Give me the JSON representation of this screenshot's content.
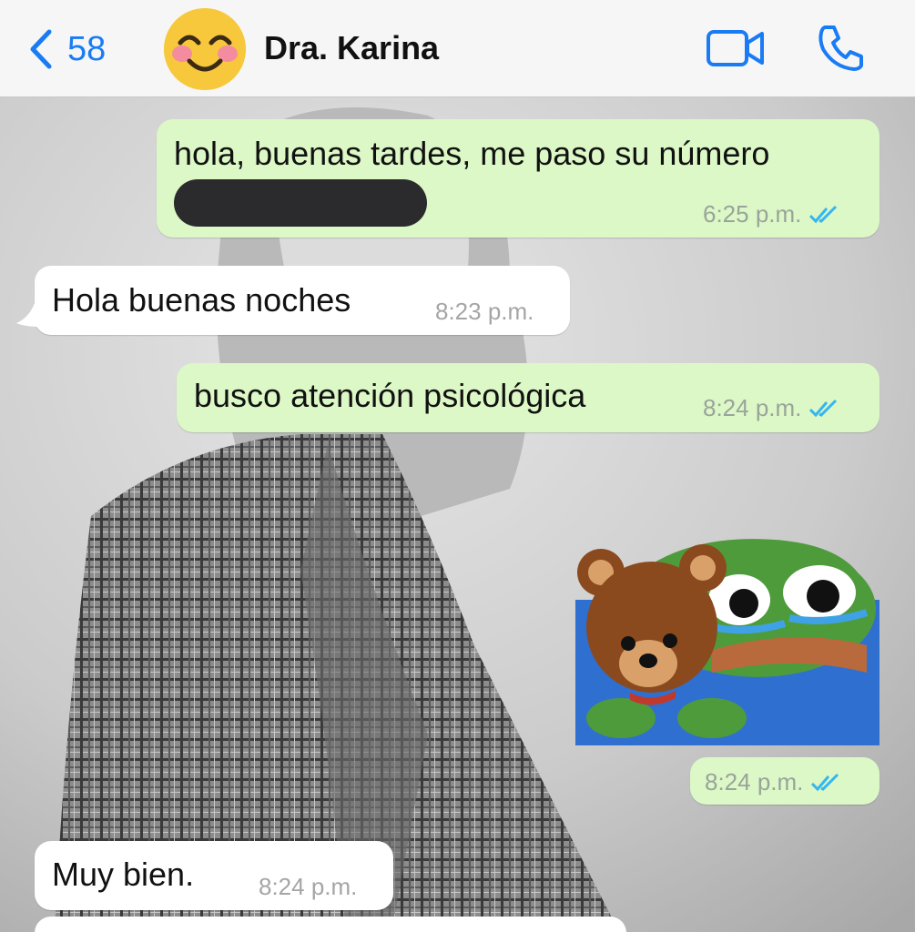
{
  "header": {
    "back_count": "58",
    "contact_name": "Dra. Karina",
    "avatar_emoji": "smiling-face-with-smiling-eyes"
  },
  "colors": {
    "accent": "#1a7cf5",
    "outgoing_bubble": "#dcf8c6",
    "incoming_bubble": "#ffffff",
    "read_ticks": "#34b7f1"
  },
  "messages": [
    {
      "direction": "out",
      "text": "hola, buenas tardes, me paso su número",
      "time": "6:25 p.m.",
      "read": true,
      "redacted_line": true
    },
    {
      "direction": "in",
      "text": "Hola buenas noches",
      "time": "8:23 p.m."
    },
    {
      "direction": "out",
      "text": "busco atención psicológica",
      "time": "8:24 p.m.",
      "read": true
    },
    {
      "direction": "out",
      "type": "sticker",
      "sticker": "teddy-bear-and-crying-frog",
      "time": "8:24 p.m.",
      "read": true
    },
    {
      "direction": "in",
      "text": "Muy bien.",
      "time": "8:24 p.m."
    }
  ]
}
